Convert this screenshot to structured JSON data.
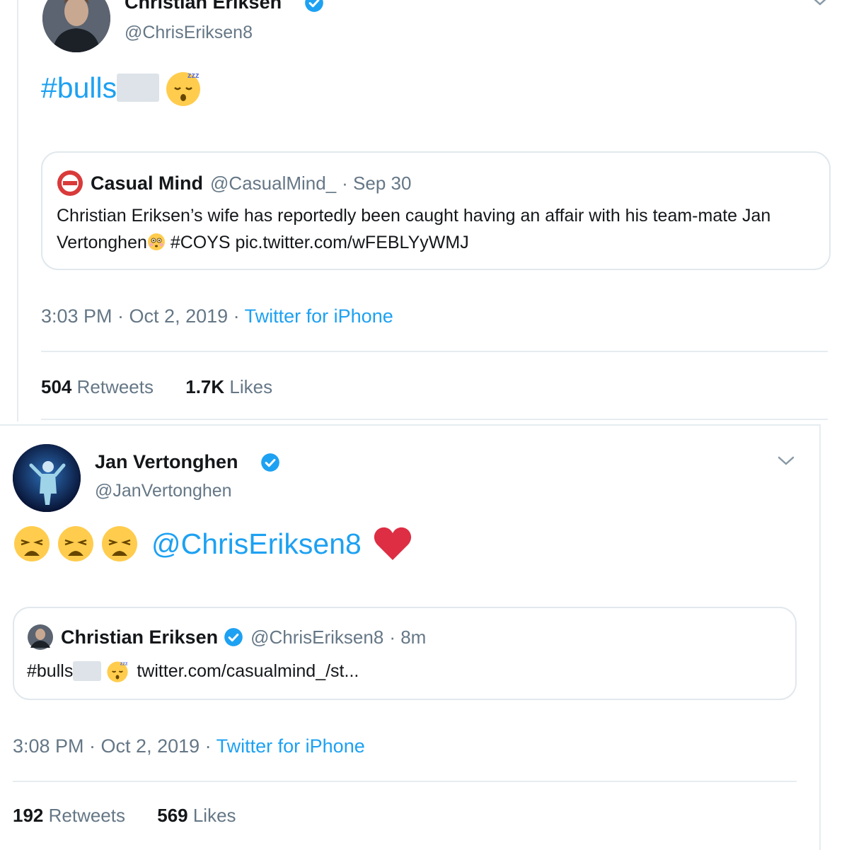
{
  "tweets": [
    {
      "author": {
        "name": "Christian Eriksen",
        "handle": "@ChrisEriksen8",
        "verified": true,
        "avatar_icon": "profile-photo"
      },
      "text": {
        "hashtag": "#bulls",
        "censored": true,
        "emoji": "sleeping-face-emoji"
      },
      "quote": {
        "name": "Casual Mind",
        "handle": "@CasualMind_",
        "date": "· Sep 30",
        "avatar_icon": "casual-mind-logo",
        "text_part1": "Christian Eriksen’s wife has reportedly been caught having an affair with his team-mate Jan Vertonghen",
        "text_part2": " #COYS pic.twitter.com/wFEBLYyWMJ",
        "emoji": "flushed-face-emoji"
      },
      "meta": {
        "time": "3:03 PM · Oct 2, 2019 · ",
        "source": "Twitter for iPhone"
      },
      "stats": {
        "retweets_count": "504",
        "retweets_label": " Retweets",
        "likes_count": "1.7K",
        "likes_label": " Likes"
      }
    },
    {
      "author": {
        "name": "Jan Vertonghen",
        "handle": "@JanVertonghen",
        "verified": true,
        "avatar_icon": "profile-photo"
      },
      "text": {
        "emojis": [
          "weary-face-emoji",
          "weary-face-emoji",
          "weary-face-emoji"
        ],
        "mention": "@ChrisEriksen8",
        "heart": "red-heart-emoji"
      },
      "quote": {
        "name": "Christian Eriksen",
        "handle": "@ChrisEriksen8",
        "date": "· 8m",
        "verified": true,
        "text_hashtag": "#bulls",
        "text_link": "twitter.com/casualmind_/st...",
        "emoji": "sleeping-face-emoji"
      },
      "meta": {
        "time": "3:08 PM · Oct 2, 2019 · ",
        "source": "Twitter for iPhone"
      },
      "stats": {
        "retweets_count": "192",
        "retweets_label": " Retweets",
        "likes_count": "569",
        "likes_label": " Likes"
      }
    }
  ],
  "colors": {
    "link": "#1da1f2",
    "muted": "#657786",
    "text": "#14171a",
    "border": "#e1e8ed",
    "heart": "#e0245e"
  }
}
